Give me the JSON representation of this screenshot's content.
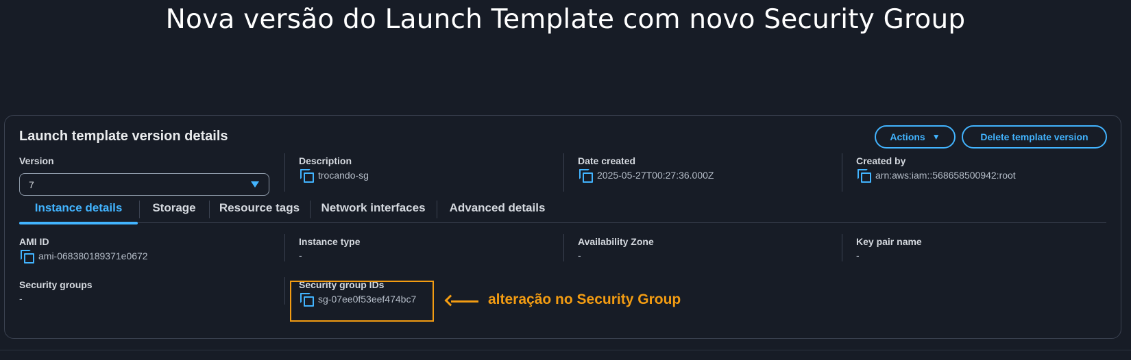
{
  "slide_title": "Nova versão do Launch Template com novo Security Group",
  "panel": {
    "title": "Launch template version details",
    "actions_label": "Actions",
    "delete_label": "Delete template version"
  },
  "summary": {
    "version_label": "Version",
    "version_value": "7",
    "description_label": "Description",
    "description_value": "trocando-sg",
    "date_label": "Date created",
    "date_value": "2025-05-27T00:27:36.000Z",
    "created_by_label": "Created by",
    "created_by_value": "arn:aws:iam::568658500942:root"
  },
  "tabs": [
    {
      "label": "Instance details",
      "active": true
    },
    {
      "label": "Storage",
      "active": false
    },
    {
      "label": "Resource tags",
      "active": false
    },
    {
      "label": "Network interfaces",
      "active": false
    },
    {
      "label": "Advanced details",
      "active": false
    }
  ],
  "details": {
    "ami_label": "AMI ID",
    "ami_value": "ami-068380189371e0672",
    "instance_type_label": "Instance type",
    "instance_type_value": "-",
    "az_label": "Availability Zone",
    "az_value": "-",
    "key_pair_label": "Key pair name",
    "key_pair_value": "-",
    "sg_label": "Security groups",
    "sg_value": "-",
    "sg_ids_label": "Security group IDs",
    "sg_ids_value": "sg-07ee0f53eef474bc7"
  },
  "annotation": "alteração no Security Group",
  "colors": {
    "accent": "#42b4ff",
    "highlight": "#f39c12",
    "background": "#171c26"
  }
}
